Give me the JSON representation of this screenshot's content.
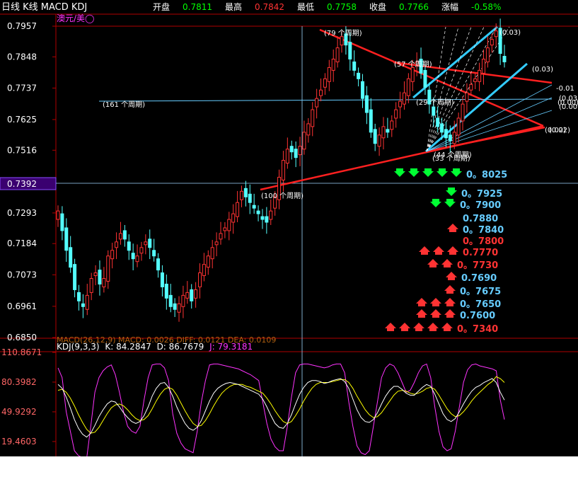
{
  "header": {
    "title": "日线 K线 MACD KDJ",
    "items": [
      {
        "label": "开盘",
        "value": "0.7811",
        "color": "#00ff00"
      },
      {
        "label": "最高",
        "value": "0.7842",
        "color": "#ff3333"
      },
      {
        "label": "最低",
        "value": "0.7758",
        "color": "#00ff00"
      },
      {
        "label": "收盘",
        "value": "0.7766",
        "color": "#00ff00"
      },
      {
        "label": "涨幅",
        "value": "-0.58%",
        "color": "#00ff00"
      }
    ]
  },
  "symbol_label": "澳元/美◯",
  "price_panel": {
    "ylim": [
      0.685,
      0.7957
    ],
    "y_ticks": [
      "0.7957",
      "0.7848",
      "0.7737",
      "0.7625",
      "0.7516",
      "0.7392",
      "0.7293",
      "0.7184",
      "0.7073",
      "0.6961",
      "0.6850"
    ],
    "current_price": "0.7392",
    "cycle_labels": [
      "(79 个周期)",
      "(57 个周期)",
      "(29 个周期)",
      "(161 个周期)",
      "(100 个周期)",
      "(33 个周期)",
      "(44 个周期)"
    ],
    "right_labels": [
      "(0.03)",
      "(0.03)",
      "-0.01",
      "(0.00)",
      "(0.03)",
      "(0.02)",
      "(0.00)",
      "(0.02)"
    ]
  },
  "targets": [
    {
      "label": "0。8025",
      "color": "#66ccff",
      "arrows": 5,
      "dir": "down"
    },
    {
      "label": "0。7925",
      "color": "#66ccff",
      "arrows": 1,
      "dir": "down"
    },
    {
      "label": "0。7900",
      "color": "#66ccff",
      "arrows": 2,
      "dir": "down"
    },
    {
      "label": "0.7880",
      "color": "#66ccff",
      "arrows": 0,
      "dir": "none"
    },
    {
      "label": "0。7840",
      "color": "#66ccff",
      "arrows": 1,
      "dir": "up"
    },
    {
      "label": "0。7800",
      "color": "#ff3333",
      "arrows": 0,
      "dir": "none"
    },
    {
      "label": "0.7770",
      "color": "#ff3333",
      "arrows": 3,
      "dir": "up"
    },
    {
      "label": "0。7730",
      "color": "#ff3333",
      "arrows": 2,
      "dir": "up"
    },
    {
      "label": "0.7690",
      "color": "#66ccff",
      "arrows": 1,
      "dir": "up"
    },
    {
      "label": "0。7675",
      "color": "#66ccff",
      "arrows": 1,
      "dir": "up"
    },
    {
      "label": "0。7650",
      "color": "#66ccff",
      "arrows": 3,
      "dir": "up"
    },
    {
      "label": "0.7600",
      "color": "#66ccff",
      "arrows": 3,
      "dir": "up"
    },
    {
      "label": "0。7340",
      "color": "#ff3333",
      "arrows": 5,
      "dir": "up"
    }
  ],
  "macd_header": "MACD(26,12,9) MACD: 0.0026 DIFF: 0.0121 DEA: 0.0109",
  "kdj_header": {
    "name": "KDJ(9,3,3)",
    "k": "K: 84.2847",
    "d": "D: 86.7679",
    "j": "J: 79.3181"
  },
  "kdj_panel": {
    "ylim": [
      10,
      110.8671
    ],
    "y_ticks": [
      "110.8671",
      "80.3982",
      "49.9292",
      "19.4603"
    ]
  },
  "colors": {
    "up": "#ff3333",
    "down": "#54ffff",
    "trend_red": "#ff2020",
    "trend_cyan": "#33ccff",
    "k_line": "#ffffff",
    "d_line": "#ffff00",
    "j_line": "#ff33ff",
    "axis": "#b00000"
  },
  "chart_data": {
    "type": "candlestick",
    "title": "日线 K线 MACD KDJ",
    "ohlc_last": {
      "open": 0.7811,
      "high": 0.7842,
      "low": 0.7758,
      "close": 0.7766,
      "change_pct": -0.58
    },
    "price_axis": {
      "min": 0.685,
      "max": 0.7957
    },
    "close_series": [
      0.73,
      0.723,
      0.716,
      0.71,
      0.702,
      0.698,
      0.696,
      0.7,
      0.706,
      0.708,
      0.704,
      0.706,
      0.714,
      0.716,
      0.719,
      0.722,
      0.72,
      0.716,
      0.713,
      0.714,
      0.717,
      0.719,
      0.717,
      0.714,
      0.709,
      0.703,
      0.699,
      0.696,
      0.695,
      0.697,
      0.7,
      0.701,
      0.698,
      0.702,
      0.708,
      0.711,
      0.714,
      0.717,
      0.719,
      0.722,
      0.724,
      0.727,
      0.729,
      0.733,
      0.737,
      0.735,
      0.733,
      0.731,
      0.729,
      0.727,
      0.726,
      0.73,
      0.735,
      0.742,
      0.748,
      0.752,
      0.751,
      0.749,
      0.753,
      0.758,
      0.761,
      0.766,
      0.77,
      0.773,
      0.777,
      0.781,
      0.784,
      0.788,
      0.792,
      0.789,
      0.784,
      0.78,
      0.777,
      0.77,
      0.765,
      0.758,
      0.754,
      0.757,
      0.76,
      0.758,
      0.762,
      0.766,
      0.769,
      0.772,
      0.777,
      0.781,
      0.783,
      0.779,
      0.774,
      0.768,
      0.764,
      0.76,
      0.758,
      0.756,
      0.755,
      0.758,
      0.763,
      0.768,
      0.772,
      0.775,
      0.777,
      0.78,
      0.784,
      0.788,
      0.791,
      0.794,
      0.786,
      0.783
    ],
    "k_series": [
      78,
      74,
      65,
      54,
      42,
      33,
      27,
      24,
      28,
      36,
      45,
      52,
      58,
      61,
      60,
      55,
      49,
      44,
      40,
      38,
      40,
      46,
      55,
      66,
      74,
      79,
      80,
      75,
      66,
      55,
      46,
      38,
      33,
      31,
      34,
      41,
      51,
      61,
      69,
      74,
      77,
      79,
      80,
      79,
      78,
      76,
      74,
      72,
      70,
      68,
      63,
      55,
      46,
      38,
      34,
      33,
      38,
      47,
      58,
      68,
      75,
      80,
      82,
      82,
      81,
      79,
      80,
      82,
      83,
      84,
      81,
      74,
      63,
      52,
      44,
      40,
      39,
      42,
      49,
      58,
      66,
      72,
      76,
      76,
      73,
      69,
      67,
      67,
      71,
      75,
      78,
      76,
      68,
      58,
      48,
      42,
      40,
      43,
      50,
      58,
      65,
      71,
      75,
      77,
      80,
      82,
      84,
      80,
      70,
      62
    ],
    "d_series": [
      72,
      73,
      70,
      64,
      56,
      47,
      39,
      32,
      28,
      29,
      34,
      41,
      48,
      54,
      57,
      58,
      56,
      52,
      47,
      43,
      41,
      42,
      46,
      53,
      61,
      68,
      73,
      75,
      73,
      67,
      59,
      51,
      44,
      38,
      35,
      36,
      41,
      48,
      56,
      63,
      69,
      73,
      76,
      78,
      78,
      78,
      76,
      75,
      73,
      71,
      69,
      64,
      58,
      51,
      45,
      40,
      38,
      40,
      46,
      53,
      61,
      68,
      74,
      78,
      80,
      80,
      80,
      81,
      82,
      83,
      83,
      80,
      74,
      66,
      59,
      52,
      47,
      44,
      45,
      49,
      55,
      61,
      67,
      71,
      72,
      71,
      69,
      68,
      69,
      71,
      74,
      75,
      73,
      67,
      60,
      53,
      48,
      45,
      46,
      50,
      55,
      61,
      66,
      70,
      74,
      78,
      81,
      86,
      84,
      80
    ],
    "j_series": [
      95,
      85,
      50,
      30,
      10,
      5,
      3,
      2,
      35,
      70,
      85,
      92,
      96,
      98,
      88,
      70,
      50,
      35,
      30,
      28,
      35,
      62,
      85,
      98,
      99,
      99,
      95,
      82,
      48,
      28,
      18,
      12,
      10,
      8,
      30,
      60,
      82,
      98,
      99,
      99,
      98,
      97,
      96,
      95,
      94,
      92,
      90,
      88,
      85,
      82,
      60,
      38,
      22,
      14,
      10,
      10,
      35,
      65,
      90,
      98,
      99,
      99,
      98,
      97,
      96,
      95,
      96,
      98,
      99,
      99,
      90,
      60,
      35,
      15,
      8,
      6,
      10,
      35,
      60,
      85,
      95,
      99,
      97,
      90,
      80,
      70,
      72,
      80,
      90,
      97,
      99,
      85,
      55,
      30,
      14,
      10,
      12,
      30,
      55,
      80,
      93,
      98,
      99,
      97,
      96,
      95,
      94,
      92,
      62,
      42
    ],
    "kdj_axis": {
      "min": 19.4603,
      "max": 110.8671
    },
    "last_kdj": {
      "K": 84.2847,
      "D": 86.7679,
      "J": 79.3181
    },
    "target_levels": [
      0.8025,
      0.7925,
      0.79,
      0.788,
      0.784,
      0.78,
      0.777,
      0.773,
      0.769,
      0.7675,
      0.765,
      0.76,
      0.734
    ]
  }
}
